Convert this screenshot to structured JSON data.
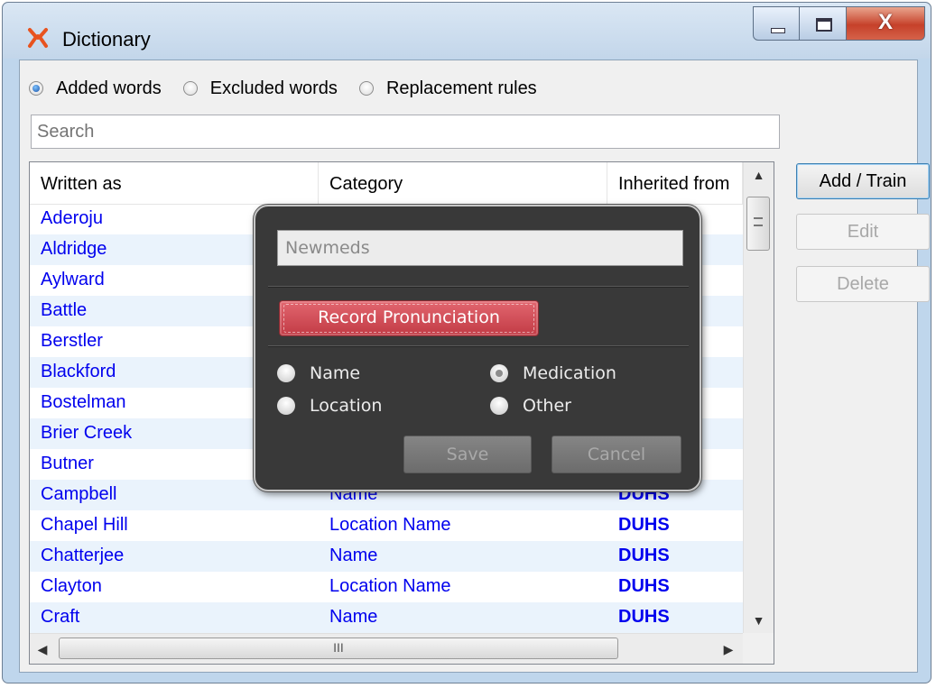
{
  "window": {
    "title": "Dictionary",
    "close_glyph": "X"
  },
  "view_mode": {
    "options": [
      "Added words",
      "Excluded words",
      "Replacement rules"
    ],
    "selected": "Added words"
  },
  "search": {
    "placeholder": "Search",
    "value": ""
  },
  "table": {
    "columns": [
      "Written as",
      "Category",
      "Inherited from"
    ],
    "rows": [
      {
        "written_as": "Aderoju",
        "category": "",
        "inherited_from": ""
      },
      {
        "written_as": "Aldridge",
        "category": "",
        "inherited_from": ""
      },
      {
        "written_as": "Aylward",
        "category": "",
        "inherited_from": ""
      },
      {
        "written_as": "Battle",
        "category": "",
        "inherited_from": ""
      },
      {
        "written_as": "Berstler",
        "category": "",
        "inherited_from": ""
      },
      {
        "written_as": "Blackford",
        "category": "",
        "inherited_from": ""
      },
      {
        "written_as": "Bostelman",
        "category": "",
        "inherited_from": ""
      },
      {
        "written_as": "Brier Creek",
        "category": "",
        "inherited_from": ""
      },
      {
        "written_as": "Butner",
        "category": "",
        "inherited_from": ""
      },
      {
        "written_as": "Campbell",
        "category": "Name",
        "inherited_from": "DUHS"
      },
      {
        "written_as": "Chapel Hill",
        "category": "Location Name",
        "inherited_from": "DUHS"
      },
      {
        "written_as": "Chatterjee",
        "category": "Name",
        "inherited_from": "DUHS"
      },
      {
        "written_as": "Clayton",
        "category": "Location Name",
        "inherited_from": "DUHS"
      },
      {
        "written_as": "Craft",
        "category": "Name",
        "inherited_from": "DUHS"
      }
    ],
    "hscroll_grip": "III"
  },
  "actions": {
    "add_train": "Add / Train",
    "edit": "Edit",
    "delete": "Delete"
  },
  "popup": {
    "word_value": "Newmeds",
    "record_label": "Record Pronunciation",
    "categories": {
      "name": "Name",
      "medication": "Medication",
      "location": "Location",
      "other": "Other"
    },
    "selected_category": "Medication",
    "save_label": "Save",
    "cancel_label": "Cancel"
  },
  "colors": {
    "link_text": "#0000ee",
    "row_alt": "#eaf3fc",
    "popup_bg": "#393939",
    "record_button": "#c23b45",
    "close_button": "#c6412a"
  }
}
